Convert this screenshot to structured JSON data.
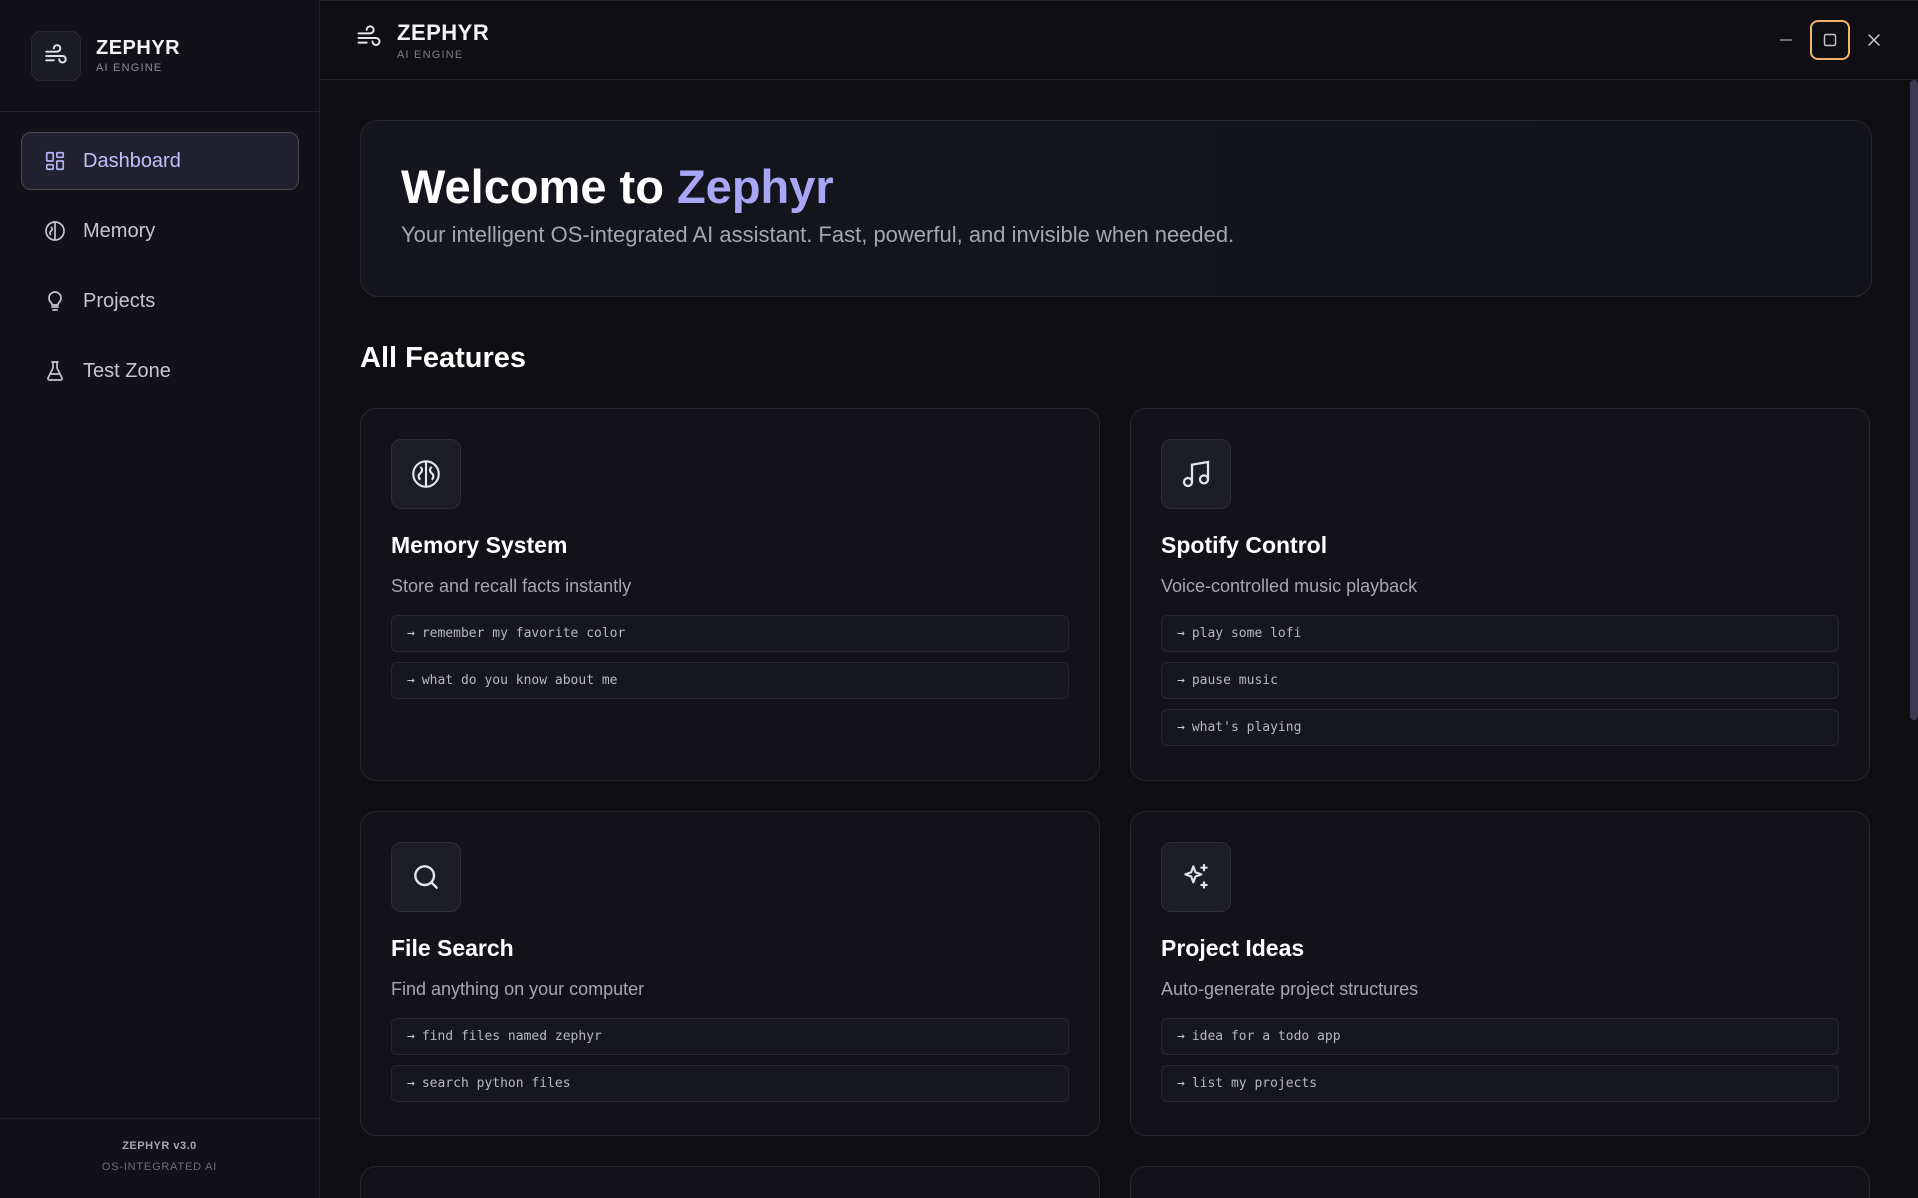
{
  "brand": {
    "title": "ZEPHYR",
    "subtitle": "AI ENGINE"
  },
  "sidebar": {
    "items": [
      {
        "label": "Dashboard",
        "icon": "dashboard-grid-icon",
        "active": true
      },
      {
        "label": "Memory",
        "icon": "brain-icon",
        "active": false
      },
      {
        "label": "Projects",
        "icon": "lightbulb-icon",
        "active": false
      },
      {
        "label": "Test Zone",
        "icon": "flask-icon",
        "active": false
      }
    ],
    "footer": {
      "version": "ZEPHYR v3.0",
      "tagline": "OS-INTEGRATED AI"
    }
  },
  "topbar": {
    "title": "ZEPHYR",
    "subtitle": "AI ENGINE",
    "icon": "wind-icon"
  },
  "window_controls": {
    "minimize": "minimize-icon",
    "maximize": "maximize-icon",
    "close": "close-icon"
  },
  "hero": {
    "title_prefix": "Welcome to ",
    "title_accent": "Zephyr",
    "subtitle": "Your intelligent OS-integrated AI assistant. Fast, powerful, and invisible when needed."
  },
  "features": {
    "heading": "All Features",
    "cards": [
      {
        "title": "Memory System",
        "description": "Store and recall facts instantly",
        "icon": "brain-icon",
        "commands": [
          "remember my favorite color",
          "what do you know about me"
        ]
      },
      {
        "title": "Spotify Control",
        "description": "Voice-controlled music playback",
        "icon": "music-note-icon",
        "commands": [
          "play some lofi",
          "pause music",
          "what's playing"
        ]
      },
      {
        "title": "File Search",
        "description": "Find anything on your computer",
        "icon": "search-icon",
        "commands": [
          "find files named zephyr",
          "search python files"
        ]
      },
      {
        "title": "Project Ideas",
        "description": "Auto-generate project structures",
        "icon": "sparkles-icon",
        "commands": [
          "idea for a todo app",
          "list my projects"
        ]
      }
    ],
    "command_arrow": "→"
  },
  "colors": {
    "accent": "#a9a6f6",
    "active_bg": "#22212f",
    "focus_ring": "#f2b36a",
    "background": "#0e0e13"
  }
}
